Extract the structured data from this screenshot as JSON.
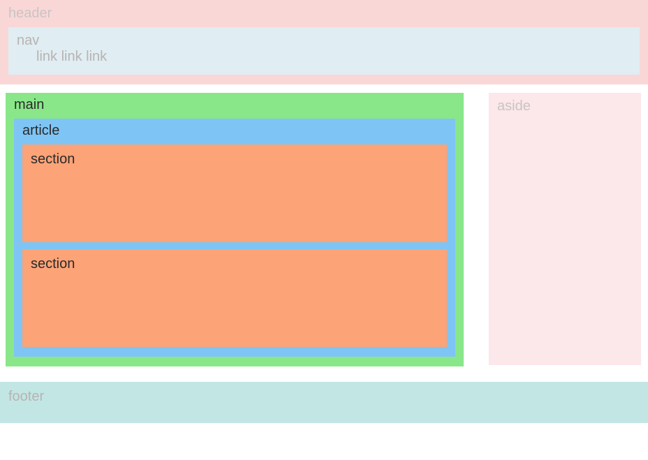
{
  "header": {
    "label": "header",
    "nav": {
      "label": "nav",
      "links": [
        "link",
        "link",
        "link"
      ]
    }
  },
  "main": {
    "label": "main",
    "article": {
      "label": "article",
      "sections": [
        {
          "label": "section"
        },
        {
          "label": "section"
        }
      ]
    }
  },
  "aside": {
    "label": "aside"
  },
  "footer": {
    "label": "footer"
  },
  "colors": {
    "header_bg": "#fad7d7",
    "nav_bg": "#e0edf2",
    "main_bg": "#89e789",
    "article_bg": "#7ec5f5",
    "section_bg": "#fca377",
    "aside_bg": "#fce7ea",
    "footer_bg": "#c2e6e4"
  }
}
